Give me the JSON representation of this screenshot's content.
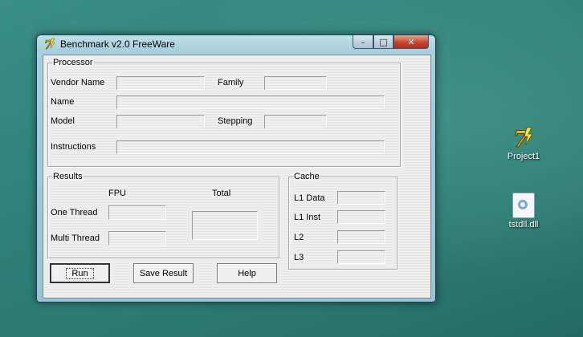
{
  "window": {
    "title": "Benchmark v2.0 FreeWare",
    "controls": {
      "minimize": "–",
      "maximize": "□",
      "close": "✕"
    }
  },
  "processor": {
    "group_title": "Processor",
    "labels": {
      "vendor_name": "Vendor Name",
      "family": "Family",
      "name": "Name",
      "model": "Model",
      "stepping": "Stepping",
      "instructions": "Instructions"
    },
    "values": {
      "vendor_name": "",
      "family": "",
      "name": "",
      "model": "",
      "stepping": "",
      "instructions": ""
    }
  },
  "results": {
    "group_title": "Results",
    "col_fpu": "FPU",
    "col_total": "Total",
    "row_one_thread": "One Thread",
    "row_multi_thread": "Multi Thread",
    "values": {
      "one_thread_fpu": "",
      "multi_thread_fpu": "",
      "total": ""
    }
  },
  "cache": {
    "group_title": "Cache",
    "labels": {
      "l1_data": "L1 Data",
      "l1_inst": "L1 Inst",
      "l2": "L2",
      "l3": "L3"
    },
    "values": {
      "l1_data": "",
      "l1_inst": "",
      "l2": "",
      "l3": ""
    }
  },
  "buttons": {
    "run": "Run",
    "save_result": "Save Result",
    "help": "Help"
  },
  "desktop": {
    "icons": [
      {
        "label": "Project1",
        "icon": "delphi-7-icon"
      },
      {
        "label": "tstdll.dll",
        "icon": "dll-file-icon"
      }
    ]
  }
}
